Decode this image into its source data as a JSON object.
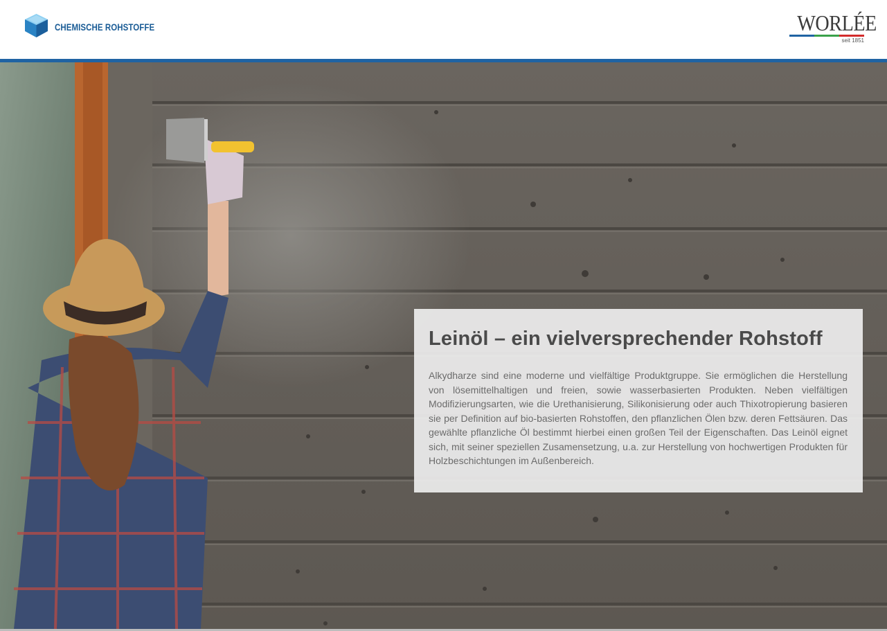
{
  "header": {
    "brand_name": "CHEMISCHE ROHSTOFFE",
    "brand_icon": "cube-logo-icon",
    "partner_logo": {
      "word": "WORLÉE",
      "tagline": "seit 1851"
    },
    "accent_color": "#1f63a3"
  },
  "hero": {
    "image": "woman-painting-wooden-wall-photo"
  },
  "panel": {
    "title": "Leinöl – ein vielversprechender Rohstoff",
    "body": "Alkydharze sind eine moderne und vielfältige Produktgruppe. Sie ermöglichen die Herstellung von lösemittelhaltigen und freien, sowie wasserbasierten Produkten. Neben vielfältigen Modifizierungsarten, wie die Urethanisierung, Silikonisierung oder auch Thixotropierung basieren sie per Definition auf bio-basierten Rohstoffen, den pflanzlichen Ölen bzw. deren Fettsäuren. Das gewählte pflanzliche Öl bestimmt hierbei einen großen Teil der Eigenschaften. Das Leinöl eignet sich, mit seiner speziellen Zusamensetzung, u.a. zur Herstellung von hochwertigen Produkten für Holzbeschichtungen im Außenbereich."
  }
}
